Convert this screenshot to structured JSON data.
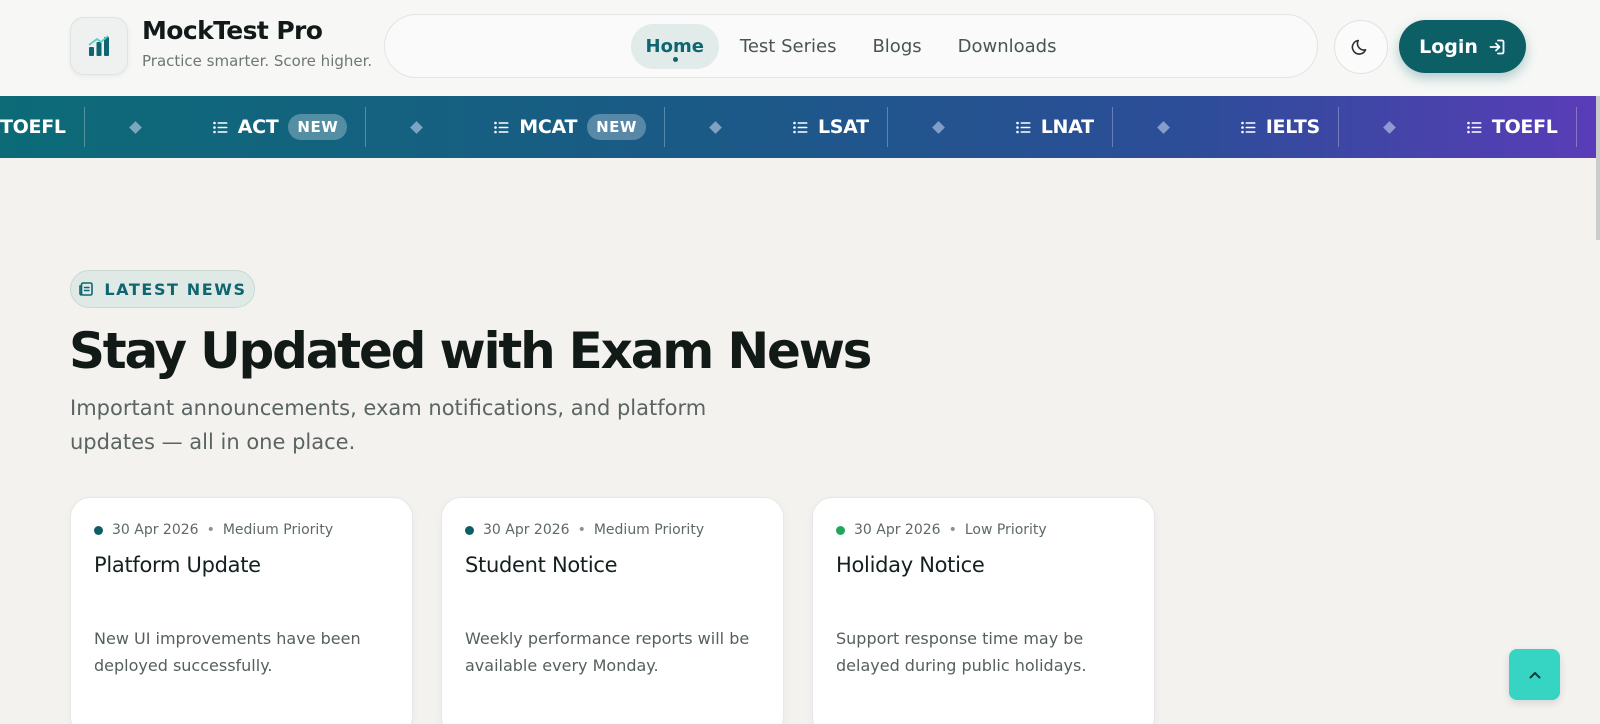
{
  "brand": {
    "name": "MockTest Pro",
    "tagline": "Practice smarter. Score higher.",
    "logo_icon": "bar-chart-icon"
  },
  "nav": {
    "items": [
      {
        "label": "Home",
        "active": true
      },
      {
        "label": "Test Series",
        "active": false
      },
      {
        "label": "Blogs",
        "active": false
      },
      {
        "label": "Downloads",
        "active": false
      }
    ]
  },
  "header_actions": {
    "theme_icon": "moon-icon",
    "login_label": "Login",
    "login_icon": "login-arrow-icon"
  },
  "ticker": {
    "items": [
      {
        "label": "TOEFL",
        "badge": ""
      },
      {
        "label": "ACT",
        "badge": "NEW"
      },
      {
        "label": "MCAT",
        "badge": "NEW"
      },
      {
        "label": "LSAT",
        "badge": ""
      },
      {
        "label": "LNAT",
        "badge": ""
      },
      {
        "label": "IELTS",
        "badge": ""
      },
      {
        "label": "TOEFL",
        "badge": ""
      }
    ],
    "item_icon": "list-icon"
  },
  "news": {
    "badge": "LATEST NEWS",
    "badge_icon": "newspaper-icon",
    "title": "Stay Updated with Exam News",
    "description": "Important announcements, exam notifications, and platform updates — all in one place.",
    "cards": [
      {
        "date": "30 Apr 2026",
        "priority": "Medium Priority",
        "dot_color": "#0d5f66",
        "title": "Platform Update",
        "body": "New UI improvements have been deployed successfully."
      },
      {
        "date": "30 Apr 2026",
        "priority": "Medium Priority",
        "dot_color": "#0d5f66",
        "title": "Student Notice",
        "body": "Weekly performance reports will be available every Monday."
      },
      {
        "date": "30 Apr 2026",
        "priority": "Low Priority",
        "dot_color": "#1fa65a",
        "title": "Holiday Notice",
        "body": "Support response time may be delayed during public holidays."
      }
    ]
  },
  "scroll_top": {
    "icon": "chevron-up-icon"
  },
  "colors": {
    "accent": "#0d5f66",
    "ticker_start": "#0c6b77",
    "ticker_end": "#5a3cb8",
    "scroll_top": "#35d4c3"
  }
}
